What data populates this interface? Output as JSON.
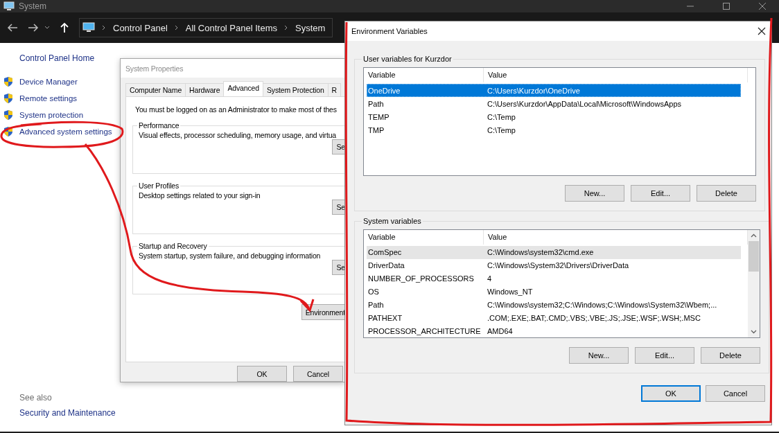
{
  "window": {
    "title": "System"
  },
  "address_bar": {
    "crumbs": [
      "Control Panel",
      "All Control Panel Items",
      "System"
    ]
  },
  "sidebar": {
    "home": "Control Panel Home",
    "items": [
      {
        "label": "Device Manager"
      },
      {
        "label": "Remote settings"
      },
      {
        "label": "System protection"
      },
      {
        "label": "Advanced system settings"
      }
    ],
    "see_also": "See also",
    "links": [
      "Security and Maintenance"
    ]
  },
  "system_properties": {
    "title": "System Properties",
    "tabs": [
      {
        "label": "Computer Name",
        "selected": false
      },
      {
        "label": "Hardware",
        "selected": false
      },
      {
        "label": "Advanced",
        "selected": true
      },
      {
        "label": "System Protection",
        "selected": false
      },
      {
        "label": "R",
        "selected": false
      }
    ],
    "notice": "You must be logged on as an Administrator to make most of thes",
    "groups": [
      {
        "title": "Performance",
        "description": "Visual effects, processor scheduling, memory usage, and virtua",
        "button": "Se"
      },
      {
        "title": "User Profiles",
        "description": "Desktop settings related to your sign-in",
        "button": "Se"
      },
      {
        "title": "Startup and Recovery",
        "description": "System startup, system failure, and debugging information",
        "button": "Se"
      }
    ],
    "environment_button": "Environment",
    "buttons": [
      "OK",
      "Cancel"
    ]
  },
  "environment_dialog": {
    "title": "Environment Variables",
    "sections": [
      {
        "title": "User variables for Kurzdor",
        "focused": true,
        "scrollbar": false,
        "columns": [
          "Variable",
          "Value"
        ],
        "rows": [
          {
            "variable": "OneDrive",
            "value": "C:\\Users\\Kurzdor\\OneDrive",
            "selected": true
          },
          {
            "variable": "Path",
            "value": "C:\\Users\\Kurzdor\\AppData\\Local\\Microsoft\\WindowsApps",
            "selected": false
          },
          {
            "variable": "TEMP",
            "value": "C:\\Temp",
            "selected": false
          },
          {
            "variable": "TMP",
            "value": "C:\\Temp",
            "selected": false
          }
        ],
        "buttons": [
          "New...",
          "Edit...",
          "Delete"
        ]
      },
      {
        "title": "System variables",
        "focused": false,
        "scrollbar": true,
        "columns": [
          "Variable",
          "Value"
        ],
        "rows": [
          {
            "variable": "ComSpec",
            "value": "C:\\Windows\\system32\\cmd.exe",
            "selected": true
          },
          {
            "variable": "DriverData",
            "value": "C:\\Windows\\System32\\Drivers\\DriverData",
            "selected": false
          },
          {
            "variable": "NUMBER_OF_PROCESSORS",
            "value": "4",
            "selected": false
          },
          {
            "variable": "OS",
            "value": "Windows_NT",
            "selected": false
          },
          {
            "variable": "Path",
            "value": "C:\\Windows\\system32;C:\\Windows;C:\\Windows\\System32\\Wbem;...",
            "selected": false
          },
          {
            "variable": "PATHEXT",
            "value": ".COM;.EXE;.BAT;.CMD;.VBS;.VBE;.JS;.JSE;.WSF;.WSH;.MSC",
            "selected": false
          },
          {
            "variable": "PROCESSOR_ARCHITECTURE",
            "value": "AMD64",
            "selected": false
          }
        ],
        "buttons": [
          "New...",
          "Edit...",
          "Delete"
        ]
      }
    ],
    "buttons": [
      {
        "label": "OK",
        "default": true
      },
      {
        "label": "Cancel",
        "default": false
      }
    ]
  }
}
